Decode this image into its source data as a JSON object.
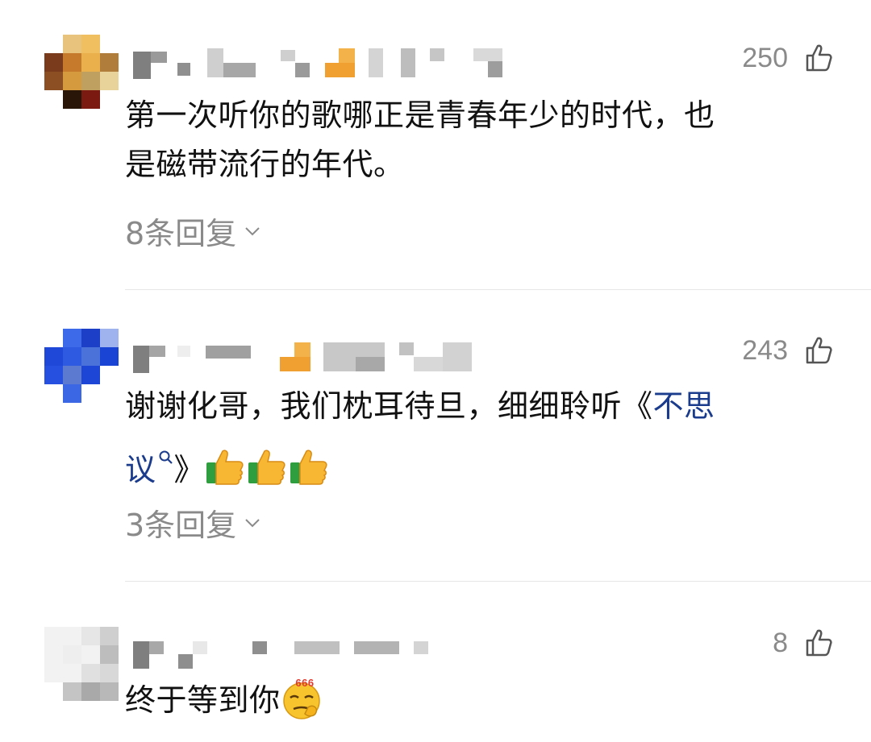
{
  "comments": [
    {
      "likes": "250",
      "text_lines": [
        "第一次听你的歌哪正是青春年少的时代，也",
        "是磁带流行的年代。"
      ],
      "replies_label": "8条回复"
    },
    {
      "likes": "243",
      "text_line1_plain": "谢谢化哥，我们枕耳待旦，细细聆听《",
      "link_part1": "不思",
      "link_part2": "议",
      "text_line2_close": "》",
      "replies_label": "3条回复"
    },
    {
      "likes": "8",
      "text": "终于等到你",
      "emoji_text": "666"
    }
  ],
  "icons": {
    "like": "thumbs-up-outline-icon",
    "expand": "chevron-down-icon",
    "search": "search-icon",
    "thumb_emoji": "thumbs-up-emoji",
    "emoji_666": "666-emoji"
  },
  "colors": {
    "text": "#111111",
    "meta": "#8a8a8a",
    "link": "#1b3c8c",
    "divider": "#e6e6e6"
  }
}
